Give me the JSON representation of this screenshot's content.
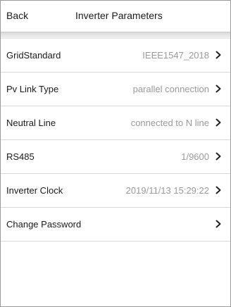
{
  "header": {
    "back_label": "Back",
    "title": "Inverter Parameters"
  },
  "rows": [
    {
      "label": "GridStandard",
      "value": "IEEE1547_2018"
    },
    {
      "label": "Pv Link Type",
      "value": "parallel connection"
    },
    {
      "label": "Neutral Line",
      "value": "connected to N line"
    },
    {
      "label": "RS485",
      "value": "1/9600"
    },
    {
      "label": "Inverter Clock",
      "value": "2019/11/13 15:29:22"
    },
    {
      "label": "Change Password",
      "value": ""
    }
  ],
  "icons": {
    "row_chevron": "chevron-right-icon"
  }
}
